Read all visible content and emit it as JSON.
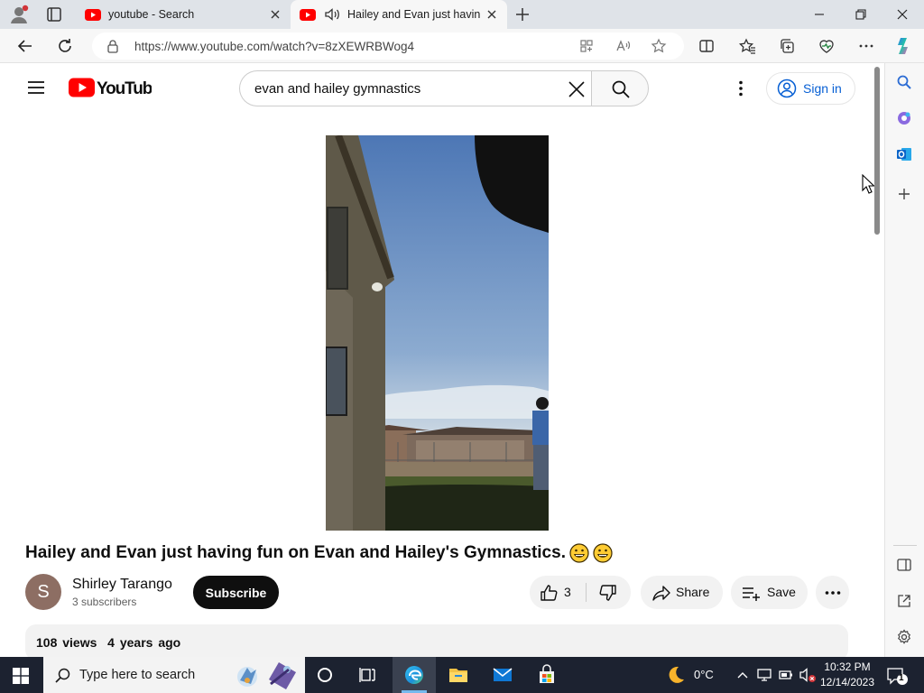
{
  "browser": {
    "tabs": [
      {
        "title": "youtube - Search",
        "active": false
      },
      {
        "title": "Hailey and Evan just having fun on Evan and Hailey's Gymnastics",
        "active": true
      }
    ],
    "url": "https://www.youtube.com/watch?v=8zXEWRBWog4"
  },
  "youtube": {
    "logo_text": "YouTube",
    "search_query": "evan and hailey gymnastics",
    "sign_in_label": "Sign in",
    "video_title": "Hailey and Evan just having fun on Evan and Hailey's Gymnastics.",
    "channel": {
      "avatar_letter": "S",
      "name": "Shirley Tarango",
      "subscribers": "3 subscribers"
    },
    "subscribe_label": "Subscribe",
    "like_count": "3",
    "share_label": "Share",
    "save_label": "Save",
    "views": "108 views",
    "age": "4 years ago"
  },
  "taskbar": {
    "search_placeholder": "Type here to search",
    "temperature": "0°C",
    "time": "10:32 PM",
    "date": "12/14/2023",
    "notification_count": "1"
  },
  "colors": {
    "youtube_red": "#ff0000",
    "link_blue": "#065fd4",
    "taskbar": "#1c2230",
    "tab_strip": "#dfe3e8"
  },
  "icons": [
    "profile-icon",
    "tab-actions-icon",
    "youtube-favicon",
    "speaker-icon",
    "close-tab-icon",
    "new-tab-icon",
    "minimize-icon",
    "restore-icon",
    "close-window-icon",
    "back-icon",
    "refresh-icon",
    "lock-icon",
    "apps-icon",
    "read-aloud-icon",
    "favorite-star-icon",
    "split-screen-icon",
    "favorites-icon",
    "collections-icon",
    "browser-essentials-icon",
    "more-icon",
    "copilot-icon",
    "hamburger-menu-icon",
    "search-icon",
    "clear-icon",
    "kebab-icon",
    "account-icon",
    "like-icon",
    "dislike-icon",
    "share-icon",
    "save-playlist-icon",
    "more-actions-icon",
    "windows-start-icon",
    "task-view-icon",
    "cortana-icon",
    "edge-icon",
    "file-explorer-icon",
    "mail-icon",
    "store-icon",
    "weather-moon-icon",
    "chevron-up-icon",
    "network-icon",
    "volume-muted-icon",
    "notification-icon"
  ]
}
